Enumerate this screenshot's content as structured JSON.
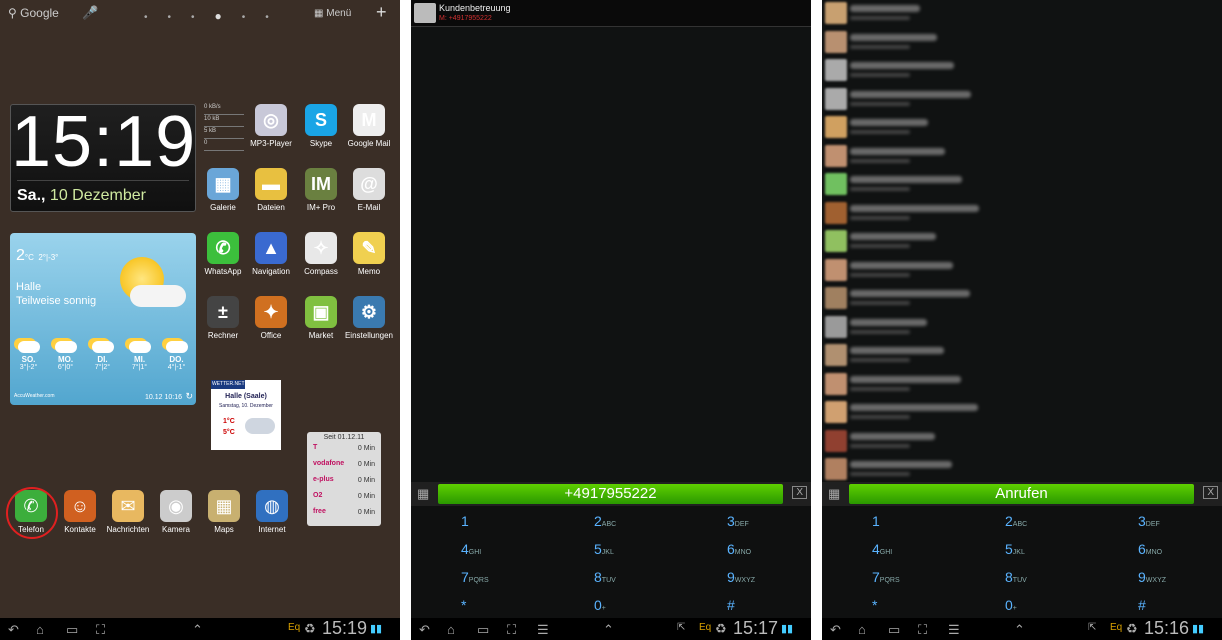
{
  "panel1": {
    "search_label": "Google",
    "menu_label": "Menü",
    "clock_time": "15:19",
    "clock_day": "Sa.,",
    "clock_date": "10 Dezember",
    "net_rates": [
      "0 kB/s",
      "10 kB",
      "5 kB",
      "0"
    ],
    "weather": {
      "temp": "2",
      "unit": "°C",
      "range": "2°|-3°",
      "city": "Halle",
      "condition": "Teilweise sonnig",
      "days": [
        {
          "name": "SO.",
          "temps": "3°|-2°"
        },
        {
          "name": "MO.",
          "temps": "6°|0°"
        },
        {
          "name": "DI.",
          "temps": "7°|2°"
        },
        {
          "name": "MI.",
          "temps": "7°|1°"
        },
        {
          "name": "DO.",
          "temps": "4°|-1°"
        }
      ],
      "brand": "AccuWeather.com",
      "updated": "10.12 10:16"
    },
    "apps": [
      {
        "label": "MP3-Player",
        "icon": "cd-icon",
        "color": "#c8c8d8"
      },
      {
        "label": "Skype",
        "icon": "skype-icon",
        "color": "#1aa5e6"
      },
      {
        "label": "Google Mail",
        "icon": "gmail-icon",
        "color": "#eeeeee"
      },
      {
        "label": "Galerie",
        "icon": "gallery-icon",
        "color": "#6aa6d8"
      },
      {
        "label": "Dateien",
        "icon": "folder-icon",
        "color": "#e8c040"
      },
      {
        "label": "IM+ Pro",
        "icon": "im-icon",
        "color": "#6a8040"
      },
      {
        "label": "E-Mail",
        "icon": "email-icon",
        "color": "#dddddd"
      },
      {
        "label": "WhatsApp",
        "icon": "whatsapp-icon",
        "color": "#3cbf3c"
      },
      {
        "label": "Navigation",
        "icon": "navigation-icon",
        "color": "#3a6ad0"
      },
      {
        "label": "Compass",
        "icon": "compass-icon",
        "color": "#e8e8e8"
      },
      {
        "label": "Memo",
        "icon": "memo-icon",
        "color": "#f0d050"
      },
      {
        "label": "Rechner",
        "icon": "calculator-icon",
        "color": "#444444"
      },
      {
        "label": "Office",
        "icon": "office-icon",
        "color": "#d07020"
      },
      {
        "label": "Market",
        "icon": "market-icon",
        "color": "#80c040"
      },
      {
        "label": "Einstellungen",
        "icon": "settings-icon",
        "color": "#3a7ab0"
      }
    ],
    "wetter_net": {
      "brand": "WETTER.NET",
      "city": "Halle (Saale)",
      "date": "Samstag, 10. Dezember",
      "high": "1°C",
      "low": "5°C"
    },
    "minutes_widget": {
      "title": "Seit 01.12.11",
      "rows": [
        "0 Min",
        "0 Min",
        "0 Min",
        "0 Min",
        "0 Min"
      ],
      "carriers": [
        "T",
        "vodafone",
        "e-plus",
        "O2",
        "free"
      ]
    },
    "dock": [
      {
        "label": "Telefon",
        "icon": "phone-icon",
        "color": "#3cae3c"
      },
      {
        "label": "Kontakte",
        "icon": "contacts-icon",
        "color": "#d06020"
      },
      {
        "label": "Nachrichten",
        "icon": "messages-icon",
        "color": "#e8b860"
      },
      {
        "label": "Kamera",
        "icon": "camera-icon",
        "color": "#cccccc"
      },
      {
        "label": "Maps",
        "icon": "maps-icon",
        "color": "#c8b070"
      },
      {
        "label": "Internet",
        "icon": "internet-icon",
        "color": "#3070c0"
      }
    ],
    "status_time": "15:19"
  },
  "panel2": {
    "contact_name": "Kundenbetreuung",
    "contact_number": "M: +4917955222",
    "dial_number": "+4917955222",
    "status_time": "15:17"
  },
  "panel3": {
    "call_button": "Anrufen",
    "status_time": "15:16"
  },
  "keypad": [
    {
      "digit": "1",
      "letters": ""
    },
    {
      "digit": "2",
      "letters": "ABC"
    },
    {
      "digit": "3",
      "letters": "DEF"
    },
    {
      "digit": "4",
      "letters": "GHI"
    },
    {
      "digit": "5",
      "letters": "JKL"
    },
    {
      "digit": "6",
      "letters": "MNO"
    },
    {
      "digit": "7",
      "letters": "PQRS"
    },
    {
      "digit": "8",
      "letters": "TUV"
    },
    {
      "digit": "9",
      "letters": "WXYZ"
    },
    {
      "digit": "*",
      "letters": ""
    },
    {
      "digit": "0",
      "letters": "+"
    },
    {
      "digit": "#",
      "letters": ""
    }
  ],
  "statusbar": {
    "eq_label": "Eq"
  }
}
